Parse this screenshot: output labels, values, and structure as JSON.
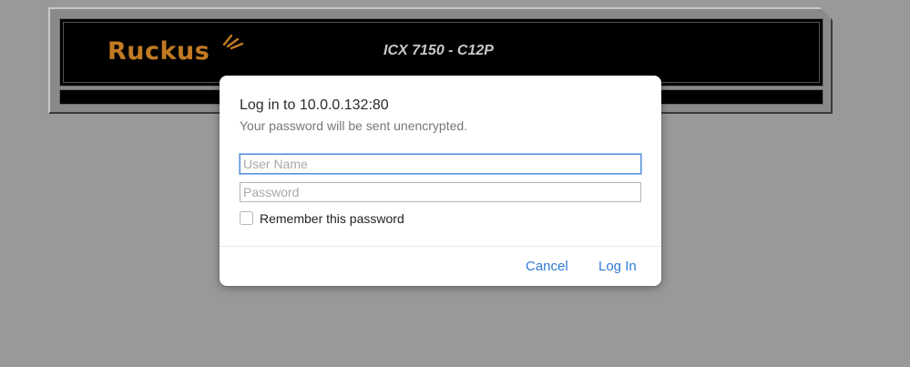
{
  "header": {
    "logo_text": "Ruckus",
    "model_title": "ICX 7150 - C12P",
    "brand_color": "#c27a23"
  },
  "dialog": {
    "title": "Log in to 10.0.0.132:80",
    "subtitle": "Your password will be sent unencrypted.",
    "username": {
      "value": "",
      "placeholder": "User Name"
    },
    "password": {
      "value": "",
      "placeholder": "Password"
    },
    "remember_label": "Remember this password",
    "remember_checked": false,
    "cancel_label": "Cancel",
    "login_label": "Log In",
    "accent_color": "#2f7bd6"
  }
}
